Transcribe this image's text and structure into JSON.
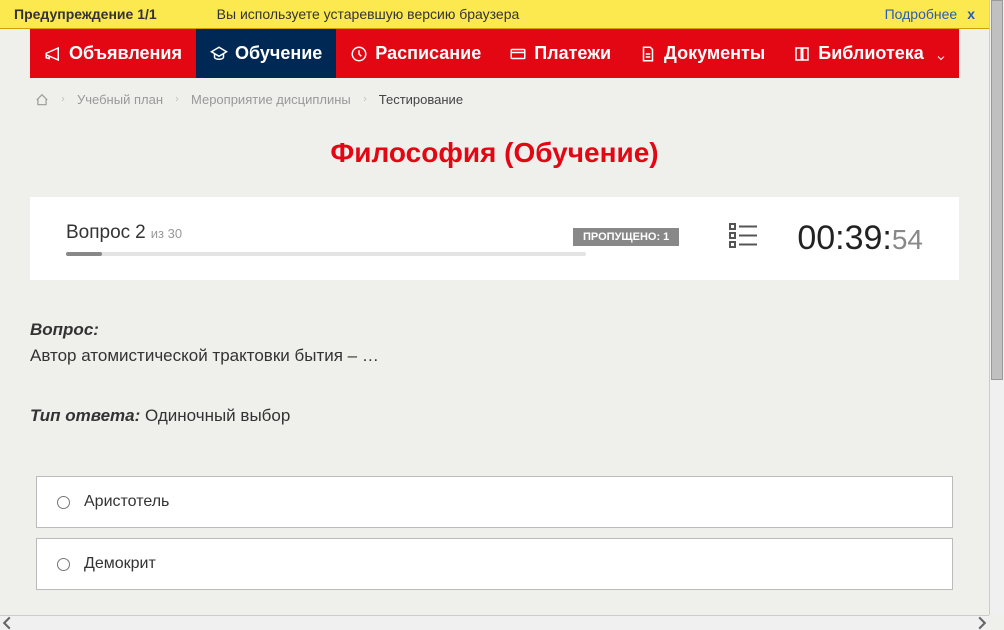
{
  "warning": {
    "label": "Предупреждение 1/1",
    "text": "Вы используете устаревшую версию браузера",
    "more": "Подробнее",
    "close": "x"
  },
  "nav": {
    "items": [
      {
        "label": "Объявления"
      },
      {
        "label": "Обучение"
      },
      {
        "label": "Расписание"
      },
      {
        "label": "Платежи"
      },
      {
        "label": "Документы"
      },
      {
        "label": "Библиотека"
      }
    ]
  },
  "breadcrumb": {
    "items": [
      {
        "label": "Учебный план"
      },
      {
        "label": "Мероприятие дисциплины"
      }
    ],
    "current": "Тестирование"
  },
  "page_title": "Философия (Обучение)",
  "question_header": {
    "label": "Вопрос",
    "number": "2",
    "of": "из",
    "total": "30",
    "skipped_label": "ПРОПУЩЕНО: 1"
  },
  "timer": {
    "main": "00:39:",
    "sec": "54"
  },
  "question": {
    "label": "Вопрос:",
    "text": "Автор атомистической трактовки бытия – …"
  },
  "answer_type": {
    "label": "Тип ответа:",
    "value": " Одиночный выбор"
  },
  "options": [
    {
      "label": "Аристотель"
    },
    {
      "label": "Демокрит"
    }
  ]
}
